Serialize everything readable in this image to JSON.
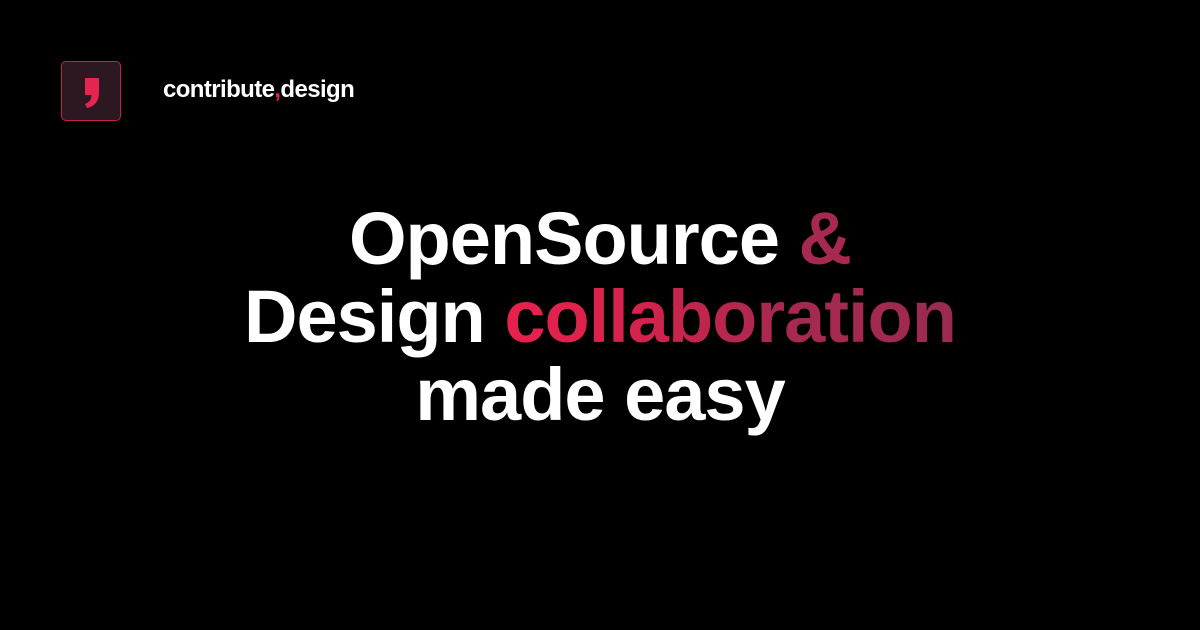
{
  "brand": {
    "name_part1": "contribute",
    "comma": ",",
    "name_part2": "design",
    "logo_icon": "comma-logo-icon",
    "colors": {
      "accent": "#e3254f",
      "logo_border": "#c2204a",
      "logo_background": "#2c1820"
    }
  },
  "headline": {
    "line1_text": "OpenSource",
    "line1_accent": "&",
    "line2_text": "Design",
    "line2_accent": "collaboration",
    "line3_text": "made easy"
  },
  "colors": {
    "background": "#000000",
    "text": "#ffffff",
    "ampersand": "#a8294f",
    "gradient_start": "#e8214d",
    "gradient_end": "#9a2b50"
  }
}
